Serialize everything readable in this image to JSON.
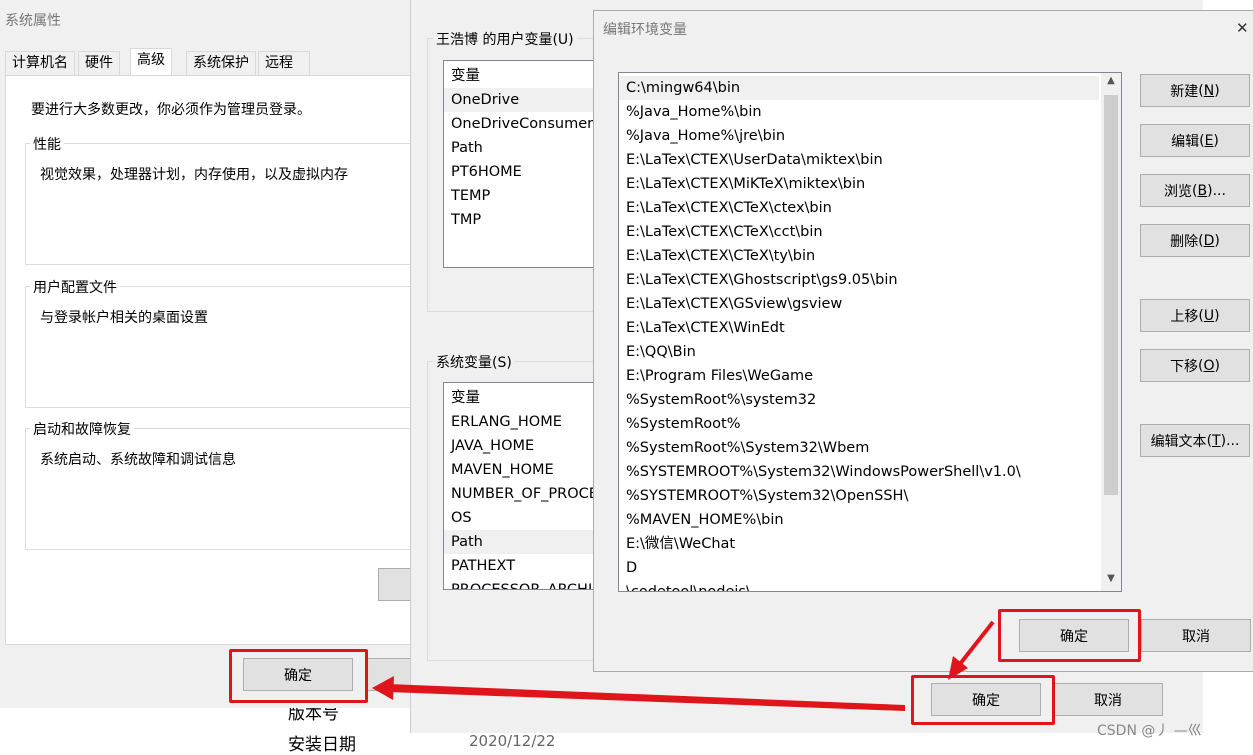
{
  "sys_props": {
    "title": "系统属性",
    "tabs": [
      "计算机名",
      "硬件",
      "高级",
      "系统保护",
      "远程"
    ],
    "admin_note": "要进行大多数更改，你必须作为管理员登录。",
    "performance": {
      "title": "性能",
      "desc": "视觉效果，处理器计划，内存使用，以及虚拟内存"
    },
    "user_profile": {
      "title": "用户配置文件",
      "desc": "与登录帐户相关的桌面设置"
    },
    "startup": {
      "title": "启动和故障恢复",
      "desc": "系统启动、系统故障和调试信息"
    },
    "ok_label": "确定"
  },
  "background": {
    "version_label": "版本号",
    "install_date_label": "安装日期",
    "install_date_value": "2020/12/22"
  },
  "env_vars": {
    "user_group_title": "王浩博 的用户变量(U)",
    "user_header": "变量",
    "user_vars": [
      "OneDrive",
      "OneDriveConsumer",
      "Path",
      "PT6HOME",
      "TEMP",
      "TMP"
    ],
    "sys_group_title": "系统变量(S)",
    "sys_header": "变量",
    "sys_vars": [
      "ERLANG_HOME",
      "JAVA_HOME",
      "MAVEN_HOME",
      "NUMBER_OF_PROCE",
      "OS",
      "Path",
      "PATHEXT",
      "PROCESSOR_ARCHI"
    ],
    "ok_label": "确定",
    "cancel_label": "取消"
  },
  "edit_env": {
    "title": "编辑环境变量",
    "paths": [
      "C:\\mingw64\\bin",
      "%Java_Home%\\bin",
      "%Java_Home%\\jre\\bin",
      "E:\\LaTex\\CTEX\\UserData\\miktex\\bin",
      "E:\\LaTex\\CTEX\\MiKTeX\\miktex\\bin",
      "E:\\LaTex\\CTEX\\CTeX\\ctex\\bin",
      "E:\\LaTex\\CTEX\\CTeX\\cct\\bin",
      "E:\\LaTex\\CTEX\\CTeX\\ty\\bin",
      "E:\\LaTex\\CTEX\\Ghostscript\\gs9.05\\bin",
      "E:\\LaTex\\CTEX\\GSview\\gsview",
      "E:\\LaTex\\CTEX\\WinEdt",
      "E:\\QQ\\Bin",
      "E:\\Program Files\\WeGame",
      "%SystemRoot%\\system32",
      "%SystemRoot%",
      "%SystemRoot%\\System32\\Wbem",
      "%SYSTEMROOT%\\System32\\WindowsPowerShell\\v1.0\\",
      "%SYSTEMROOT%\\System32\\OpenSSH\\",
      "%MAVEN_HOME%\\bin",
      "E:\\微信\\WeChat",
      "D",
      "\\codetool\\nodejs\\"
    ],
    "new_label": "新建",
    "new_key": "N",
    "edit_label": "编辑",
    "edit_key": "E",
    "browse_label": "浏览",
    "browse_key": "B",
    "browse_suffix": "...",
    "delete_label": "删除",
    "delete_key": "D",
    "up_label": "上移",
    "up_key": "U",
    "down_label": "下移",
    "down_key": "O",
    "edit_text_label": "编辑文本",
    "edit_text_key": "T",
    "edit_text_suffix": "...",
    "ok_label": "确定",
    "cancel_label": "取消",
    "close_glyph": "✕"
  },
  "watermark": "CSDN @丿 —巛",
  "colors": {
    "annotation_red": "#e0151b",
    "selection": "#f0f0f0",
    "window_bg": "#f0f0f0"
  }
}
